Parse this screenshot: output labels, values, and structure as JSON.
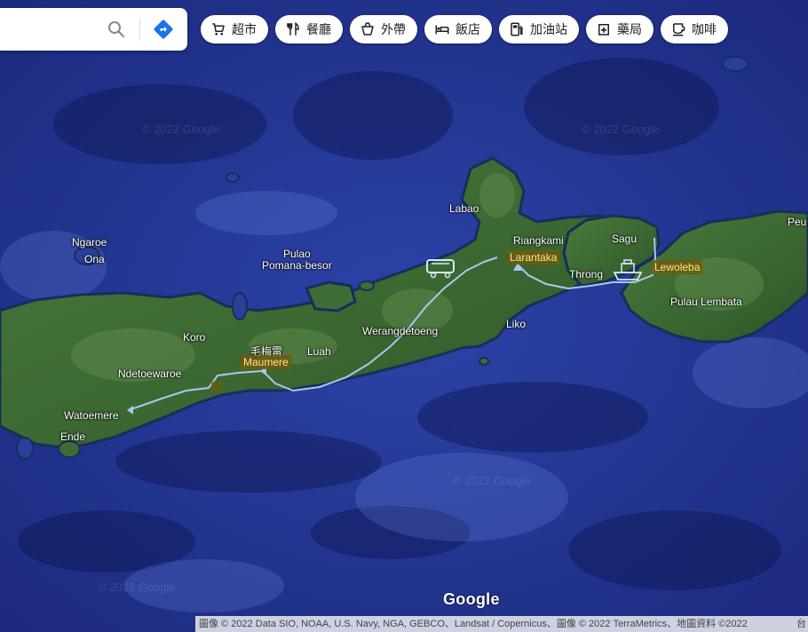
{
  "search": {
    "placeholder": "",
    "value": ""
  },
  "icons": {
    "search": "search-icon",
    "directions": "directions-icon"
  },
  "chips": [
    {
      "label": "超市",
      "icon": "cart-icon"
    },
    {
      "label": "餐廳",
      "icon": "restaurant-icon"
    },
    {
      "label": "外帶",
      "icon": "takeout-icon"
    },
    {
      "label": "飯店",
      "icon": "hotel-icon"
    },
    {
      "label": "加油站",
      "icon": "gas-station-icon"
    },
    {
      "label": "藥局",
      "icon": "pharmacy-icon"
    },
    {
      "label": "咖啡",
      "icon": "coffee-icon"
    }
  ],
  "places": {
    "ngaroe": "Ngaroe",
    "ona": "Ona",
    "pulao": "Pulao",
    "pomana": "Pomana-besor",
    "labao": "Labao",
    "riangkami": "Riangkami",
    "sagu": "Sagu",
    "larantaka": "Larantaka",
    "lewoleba": "Lewoleba",
    "throng": "Throng",
    "peu": "Peu",
    "pulau_lembata": "Pulau Lembata",
    "liko": "Liko",
    "werangdetoeng": "Werangdetoeng",
    "koro": "Koro",
    "maumere_cn": "毛梅雷",
    "maumere": "Maumere",
    "luah": "Luah",
    "ndetoewaroe": "Ndetoewaroe",
    "watoemere": "Watoemere",
    "ende": "Ende"
  },
  "watermark": "© 2022 Google",
  "logo": "Google",
  "attribution": "圖像 © 2022 Data SIO, NOAA, U.S. Navy, NGA, GEBCO、Landsat / Copernicus、圖像 © 2022 TerraMetrics、地圖資料 ©2022",
  "attribution_tail": "台",
  "colors": {
    "ocean": "#2a3c9e",
    "land": "#3f6b35",
    "route": "#a8c8f0",
    "city_label": "#fde293"
  }
}
